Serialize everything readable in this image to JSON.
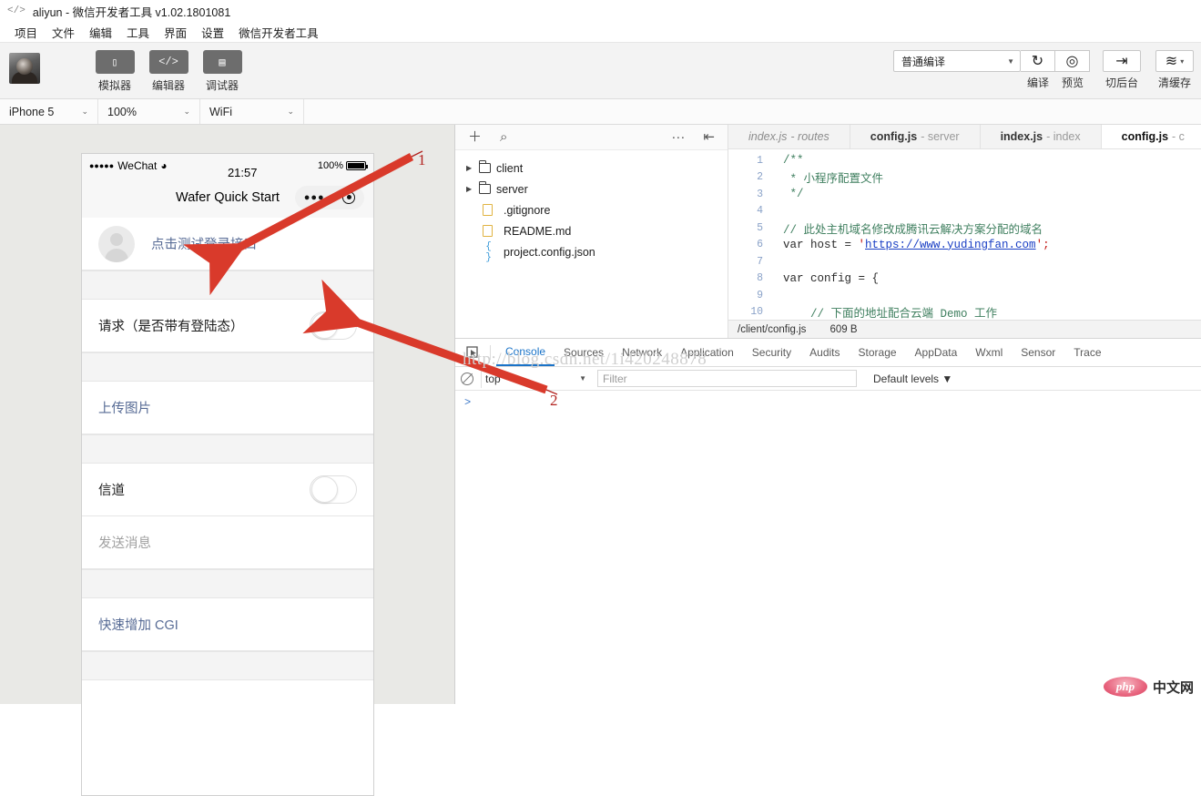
{
  "window": {
    "icon": "code-icon",
    "title": "aliyun - 微信开发者工具 v1.02.1801081"
  },
  "menubar": {
    "items": [
      "项目",
      "文件",
      "编辑",
      "工具",
      "界面",
      "设置",
      "微信开发者工具"
    ]
  },
  "toolbar": {
    "avatar_name": "user-avatar",
    "buttons": [
      {
        "icon": "phone-icon",
        "glyph": "▯",
        "label": "模拟器"
      },
      {
        "icon": "code-brackets-icon",
        "glyph": "</>",
        "label": "编辑器"
      },
      {
        "icon": "debugger-icon",
        "glyph": "▤",
        "label": "调试器"
      }
    ],
    "compile_mode": "普通编译",
    "compile_caret": "▼",
    "compile_btn": {
      "icon": "refresh-icon",
      "glyph": "↻",
      "label": "编译"
    },
    "preview_btn": {
      "icon": "eye-icon",
      "glyph": "◎",
      "label": "预览"
    },
    "background_btn": {
      "icon": "switch-background-icon",
      "glyph": "⇥",
      "label": "切后台"
    },
    "cache_btn": {
      "icon": "layers-icon",
      "glyph": "≋",
      "caret": "▾",
      "label": "清缓存"
    }
  },
  "devicebar": {
    "device": "iPhone 5",
    "scale": "100%",
    "network": "WiFi",
    "caret": "⌄"
  },
  "simulator": {
    "statusbar": {
      "signal_dots": "●●●●●",
      "carrier": "WeChat",
      "wifi_icon": "wifi-icon",
      "wifi_glyph": "⌃",
      "time": "21:57",
      "battery_percent": "100%",
      "battery_icon": "battery-icon"
    },
    "navbar": {
      "title": "Wafer Quick Start",
      "capsule_dots": "●●●",
      "capsule_target": "target-icon"
    },
    "cells": [
      {
        "type": "avatar-link",
        "name": "login-test-cell",
        "text": "点击测试登录接口",
        "style": "link"
      },
      {
        "type": "gap"
      },
      {
        "type": "switch",
        "name": "request-session-cell",
        "text": "请求（是否带有登陆态）",
        "style": "label",
        "switch_on": false
      },
      {
        "type": "gap"
      },
      {
        "type": "text",
        "name": "upload-image-cell",
        "text": "上传图片",
        "style": "link"
      },
      {
        "type": "gap"
      },
      {
        "type": "switch",
        "name": "channel-cell",
        "text": "信道",
        "style": "label",
        "switch_on": false
      },
      {
        "type": "text",
        "name": "send-message-cell",
        "text": "发送消息",
        "style": "placeholder"
      },
      {
        "type": "gap"
      },
      {
        "type": "text",
        "name": "add-cgi-cell",
        "text": "快速增加 CGI",
        "style": "link"
      },
      {
        "type": "gap"
      }
    ]
  },
  "filepane": {
    "toolbar": {
      "add_icon": "plus-icon",
      "add_glyph": "＋",
      "search_icon": "search-icon",
      "search_glyph": "⌕",
      "more_icon": "more-icon",
      "more_glyph": "···",
      "collapse_icon": "collapse-panel-icon",
      "collapse_glyph": "⇤"
    },
    "tree": [
      {
        "name": "client",
        "kind": "folder",
        "expanded": false,
        "arrow": "▶"
      },
      {
        "name": "server",
        "kind": "folder",
        "expanded": false,
        "arrow": "▶"
      },
      {
        "name": ".gitignore",
        "kind": "file"
      },
      {
        "name": "README.md",
        "kind": "file"
      },
      {
        "name": "project.config.json",
        "kind": "json",
        "glyph": "{ }"
      }
    ]
  },
  "editor": {
    "tabs": [
      {
        "name": "index.js",
        "suffix": "- routes",
        "active": false,
        "italic": true
      },
      {
        "name": "config.js",
        "suffix": "- server",
        "active": false,
        "italic": false
      },
      {
        "name": "index.js",
        "suffix": "- index",
        "active": false,
        "italic": false
      },
      {
        "name": "config.js",
        "suffix": "- c",
        "active": true,
        "italic": false
      }
    ],
    "lines": [
      {
        "n": "1",
        "segments": [
          {
            "t": "/**",
            "c": "cm"
          }
        ]
      },
      {
        "n": "2",
        "segments": [
          {
            "t": " * 小程序配置文件",
            "c": "cm"
          }
        ]
      },
      {
        "n": "3",
        "segments": [
          {
            "t": " */",
            "c": "cm"
          }
        ]
      },
      {
        "n": "4",
        "segments": [
          {
            "t": "",
            "c": "kw"
          }
        ]
      },
      {
        "n": "5",
        "segments": [
          {
            "t": "// 此处主机域名修改成腾讯云解决方案分配的域名",
            "c": "cm"
          }
        ]
      },
      {
        "n": "6",
        "segments": [
          {
            "t": "var host = ",
            "c": "kw"
          },
          {
            "t": "'",
            "c": "str"
          },
          {
            "t": "https://www.yudingfan.com",
            "c": "lnk"
          },
          {
            "t": "';",
            "c": "str"
          }
        ]
      },
      {
        "n": "7",
        "segments": [
          {
            "t": "",
            "c": "kw"
          }
        ]
      },
      {
        "n": "8",
        "segments": [
          {
            "t": "var config = {",
            "c": "kw"
          }
        ]
      },
      {
        "n": "9",
        "segments": [
          {
            "t": "",
            "c": "kw"
          }
        ]
      },
      {
        "n": "10",
        "segments": [
          {
            "t": "    // 下面的地址配合云端 Demo 工作",
            "c": "cm"
          }
        ]
      }
    ],
    "status_path": "/client/config.js",
    "status_size": "609 B"
  },
  "devtools": {
    "inspect_icon": "inspect-element-icon",
    "inspect_glyph": "⬚",
    "tabs": [
      "Console",
      "Sources",
      "Network",
      "Application",
      "Security",
      "Audits",
      "Storage",
      "AppData",
      "Wxml",
      "Sensor",
      "Trace"
    ],
    "active_tab": "Console",
    "clear_icon": "clear-console-icon",
    "context": "top",
    "context_caret": "▼",
    "filter_placeholder": "Filter",
    "levels": "Default levels ▼",
    "prompt": ">"
  },
  "annotations": {
    "watermark": "http://blog.csdn.net/1i420248878",
    "markers": [
      {
        "label": "1",
        "name": "annotation-number-1"
      },
      {
        "label": "2",
        "name": "annotation-number-2"
      }
    ],
    "arrow_color": "#d93a2b"
  },
  "footer_logo": {
    "php_text": "php",
    "zh_text": "中文网"
  }
}
